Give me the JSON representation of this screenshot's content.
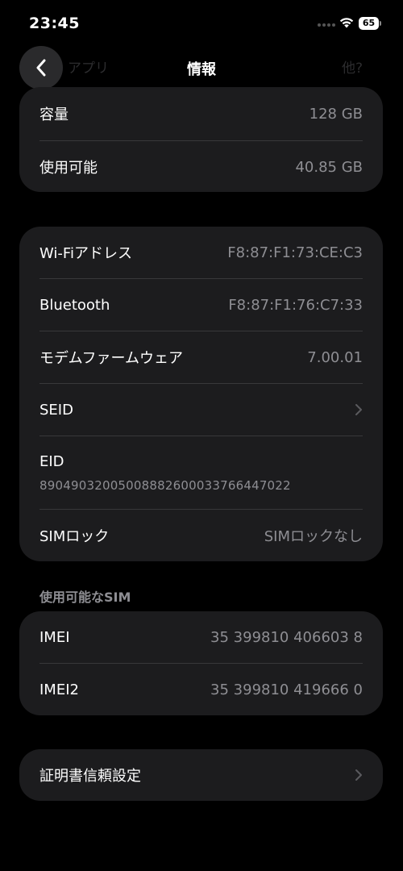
{
  "status_bar": {
    "time": "23:45",
    "battery": "65"
  },
  "nav": {
    "title": "情報",
    "ghost_left": "アプリ",
    "ghost_right": "他?"
  },
  "storage_group": {
    "rows": [
      {
        "label": "容量",
        "value": "128 GB"
      },
      {
        "label": "使用可能",
        "value": "40.85 GB"
      }
    ]
  },
  "network_group": {
    "wifi": {
      "label": "Wi-Fiアドレス",
      "value": "F8:87:F1:73:CE:C3"
    },
    "bluetooth": {
      "label": "Bluetooth",
      "value": "F8:87:F1:76:C7:33"
    },
    "modem": {
      "label": "モデムファームウェア",
      "value": "7.00.01"
    },
    "seid": {
      "label": "SEID"
    },
    "eid": {
      "label": "EID",
      "value": "89049032005008882600033766447022"
    },
    "simlock": {
      "label": "SIMロック",
      "value": "SIMロックなし"
    }
  },
  "sim_section": {
    "header": "使用可能なSIM",
    "rows": [
      {
        "label": "IMEI",
        "value": "35 399810 406603 8"
      },
      {
        "label": "IMEI2",
        "value": "35 399810 419666 0"
      }
    ]
  },
  "cert_group": {
    "label": "証明書信頼設定"
  },
  "icons": {
    "back": "chevron-left-icon",
    "chevron": "chevron-right-icon",
    "wifi": "wifi-icon",
    "battery": "battery-icon"
  },
  "colors": {
    "background": "#000000",
    "group_background": "#1c1c1e",
    "secondary_text": "#8e8e93",
    "separator": "#38383a"
  }
}
